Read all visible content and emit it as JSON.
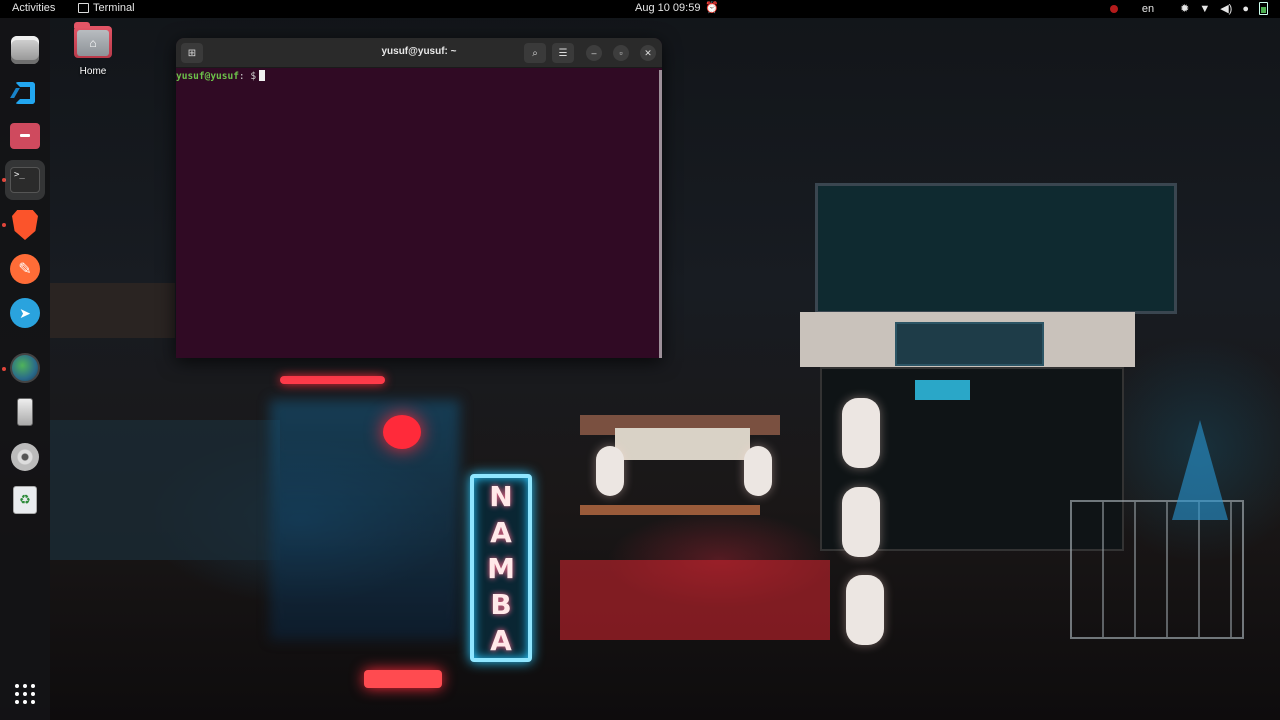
{
  "topbar": {
    "activities": "Activities",
    "app_name": "Terminal",
    "datetime": "Aug 10  09:59",
    "language": "en"
  },
  "dock": {
    "items": [
      {
        "name": "Database",
        "icon": "database-icon",
        "dot": false
      },
      {
        "name": "Visual Studio Code",
        "icon": "vscode-icon",
        "dot": false
      },
      {
        "name": "Files",
        "icon": "files-icon",
        "dot": false
      },
      {
        "name": "Terminal",
        "icon": "terminal-icon",
        "dot": true,
        "active": true
      },
      {
        "name": "Brave",
        "icon": "brave-icon",
        "dot": true
      },
      {
        "name": "Postman",
        "icon": "postman-icon",
        "dot": false
      },
      {
        "name": "Telegram",
        "icon": "telegram-icon",
        "dot": false
      },
      {
        "name": "Browser",
        "icon": "globe-icon",
        "dot": true
      },
      {
        "name": "Phone",
        "icon": "phone-icon",
        "dot": false
      },
      {
        "name": "Disc",
        "icon": "disc-icon",
        "dot": false
      },
      {
        "name": "Trash",
        "icon": "trash-icon",
        "dot": false
      }
    ],
    "show_apps_icon": "grid-icon"
  },
  "desktop": {
    "home_label": "Home"
  },
  "terminal": {
    "title": "yusuf@yusuf: ~",
    "prompt_user": "yusuf@yusuf",
    "prompt_sep": ":",
    "prompt_path": " ",
    "prompt_symbol": "$",
    "background": "#300a24",
    "prompt_color": "#6cc24a"
  },
  "wallpaper": {
    "neon_sign": [
      "N",
      "A",
      "M",
      "B",
      "A"
    ]
  }
}
